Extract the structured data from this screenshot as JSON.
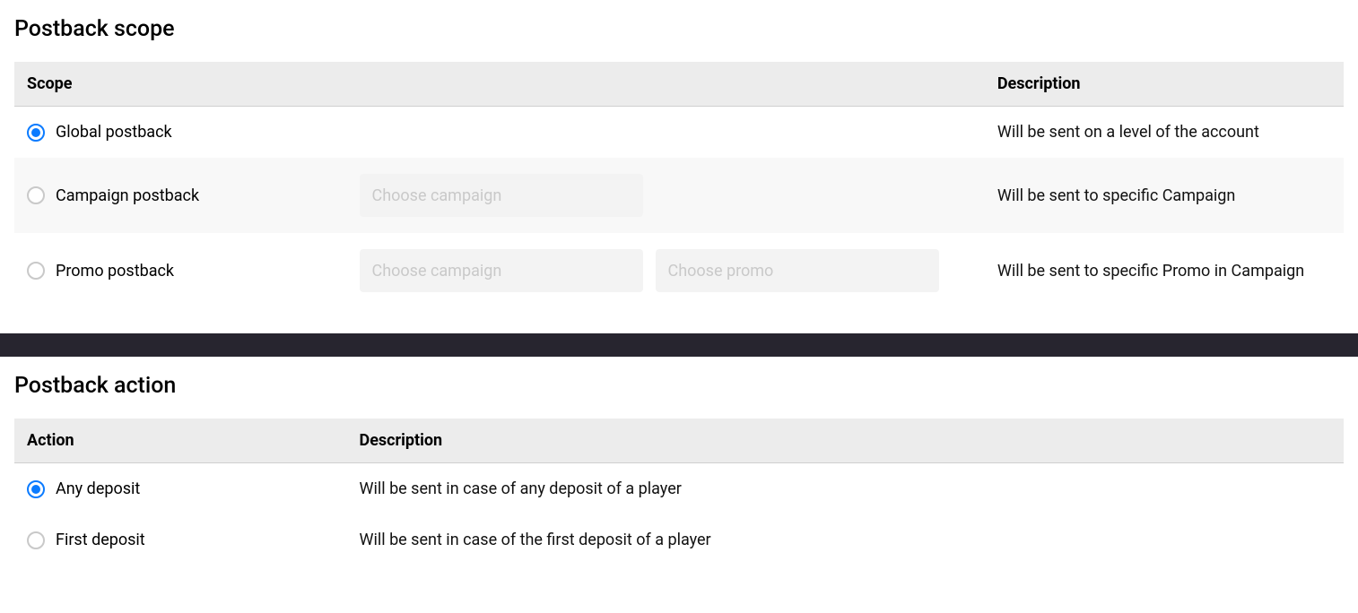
{
  "scope_section": {
    "title": "Postback scope",
    "headers": {
      "scope": "Scope",
      "description": "Description"
    },
    "rows": [
      {
        "label": "Global postback",
        "desc": "Will be sent on a level of the account"
      },
      {
        "label": "Campaign postback",
        "select1_placeholder": "Choose campaign",
        "desc": "Will be sent to specific Campaign"
      },
      {
        "label": "Promo postback",
        "select1_placeholder": "Choose campaign",
        "select2_placeholder": "Choose promo",
        "desc": "Will be sent to specific Promo in Campaign"
      }
    ]
  },
  "action_section": {
    "title": "Postback action",
    "headers": {
      "action": "Action",
      "description": "Description"
    },
    "rows": [
      {
        "label": "Any deposit",
        "desc": "Will be sent in case of any deposit of a player"
      },
      {
        "label": "First deposit",
        "desc": "Will be sent in case of the first deposit of a player"
      }
    ]
  }
}
